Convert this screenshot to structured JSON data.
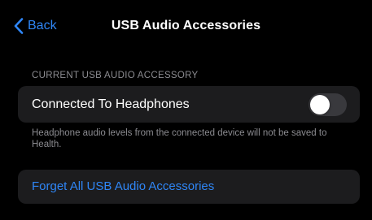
{
  "nav": {
    "back_label": "Back",
    "title": "USB Audio Accessories"
  },
  "section": {
    "header": "CURRENT USB AUDIO ACCESSORY",
    "toggle_row": {
      "label": "Connected To Headphones",
      "enabled": false
    },
    "footer": "Headphone audio levels from the connected device will not be saved to Health."
  },
  "actions": {
    "forget_label": "Forget All USB Audio Accessories"
  },
  "colors": {
    "background": "#000000",
    "group_background": "#1c1c1e",
    "accent": "#2f86f6",
    "secondary_text": "#8b8b90",
    "toggle_off": "#39393d"
  },
  "icons": {
    "back": "chevron-left-icon"
  }
}
